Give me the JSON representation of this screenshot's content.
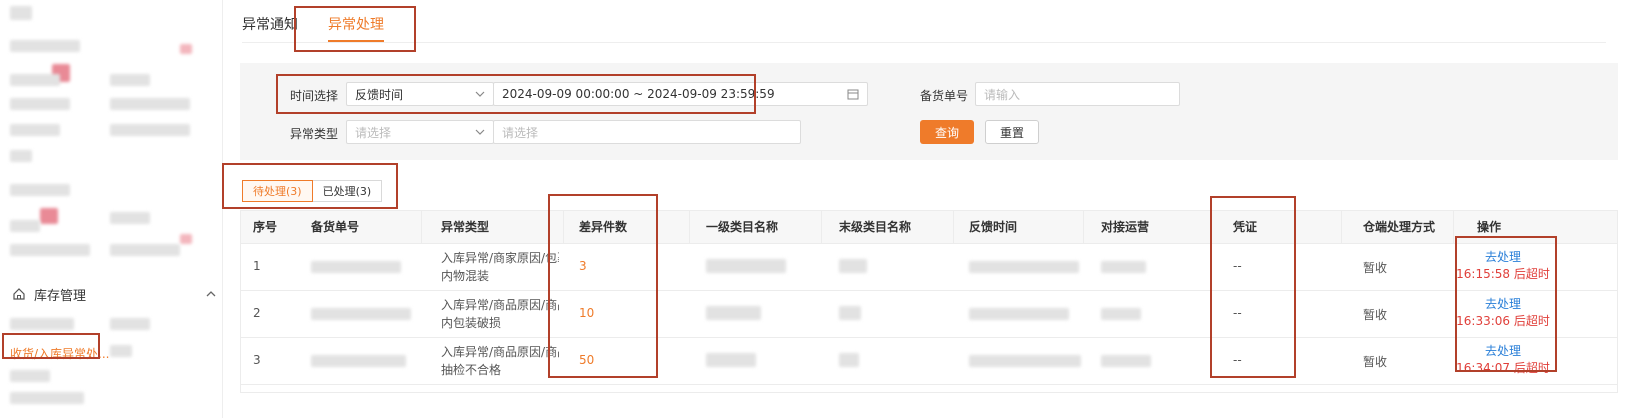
{
  "sidebar": {
    "section_label": "库存管理",
    "active_item": "收货/入库异常处..."
  },
  "tabs": [
    {
      "label": "异常通知",
      "active": false
    },
    {
      "label": "异常处理",
      "active": true
    }
  ],
  "filter": {
    "time_label": "时间选择",
    "time_type_value": "反馈时间",
    "date_range_value": "2024-09-09 00:00:00 ~ 2024-09-09 23:59:59",
    "order_label": "备货单号",
    "order_placeholder": "请输入",
    "type_label": "异常类型",
    "type_placeholder_1": "请选择",
    "type_placeholder_2": "请选择",
    "query_button": "查询",
    "reset_button": "重置"
  },
  "status_tabs": [
    {
      "label": "待处理(3)",
      "active": true
    },
    {
      "label": "已处理(3)",
      "active": false
    }
  ],
  "table": {
    "columns": [
      "序号",
      "备货单号",
      "异常类型",
      "差异件数",
      "一级类目名称",
      "末级类目名称",
      "反馈时间",
      "对接运营",
      "凭证",
      "仓端处理方式",
      "操作"
    ],
    "rows": [
      {
        "index": "1",
        "reason_line1": "入库异常/商家原因/包裹",
        "reason_line2": "内物混装",
        "diff": "3",
        "proof": "--",
        "method": "暂收",
        "action": "去处理",
        "timeout": "16:15:58 后超时"
      },
      {
        "index": "2",
        "reason_line1": "入库异常/商品原因/商品",
        "reason_line2": "内包装破损",
        "diff": "10",
        "proof": "--",
        "method": "暂收",
        "action": "去处理",
        "timeout": "16:33:06 后超时"
      },
      {
        "index": "3",
        "reason_line1": "入库异常/商品原因/商品",
        "reason_line2": "抽检不合格",
        "diff": "50",
        "proof": "--",
        "method": "暂收",
        "action": "去处理",
        "timeout": "16:34:07 后超时"
      }
    ]
  },
  "colors": {
    "accent": "#ef7b2a",
    "link": "#2a7fd8",
    "danger": "#e0403b",
    "highlight": "#b2402a"
  },
  "icons": [
    "home-icon",
    "chevron-up-icon",
    "chevron-down-icon",
    "calendar-icon"
  ]
}
